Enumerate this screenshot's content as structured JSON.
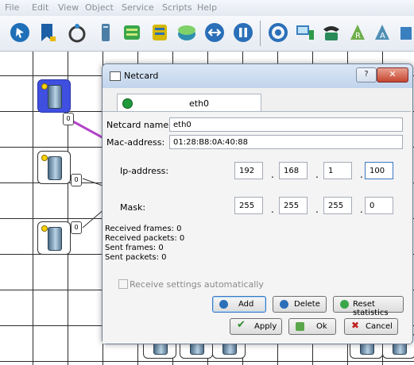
{
  "menu": [
    "File",
    "Edit",
    "View",
    "Object",
    "Service",
    "Scripts",
    "Help"
  ],
  "toolbar_icons": [
    "pointer-icon",
    "bookmark-icon",
    "cable-icon",
    "computer-icon",
    "hub-icon",
    "switch-icon",
    "router-icon",
    "connect-icon",
    "pause-icon",
    "settings-icon",
    "workstation-icon",
    "phone-icon",
    "router-r-icon",
    "router-a-icon"
  ],
  "canvas": {
    "ports": [
      "0",
      "0",
      "0"
    ]
  },
  "dialog": {
    "title": "Netcard",
    "help_label": "?",
    "close_label": "✕",
    "tab_label": "eth0",
    "netcard_name_label": "Netcard name:",
    "netcard_name": "eth0",
    "mac_label": "Mac-address:",
    "mac": "01:28:B8:0A:40:88",
    "ip_label": "Ip-address:",
    "ip": [
      "192",
      "168",
      "1",
      "100"
    ],
    "mask_label": "Mask:",
    "mask": [
      "255",
      "255",
      "255",
      "0"
    ],
    "received_frames": "Received frames: 0",
    "received_packets": "Received packets: 0",
    "sent_frames": "Sent frames: 0",
    "sent_packets": "Sent packets: 0",
    "receive_auto_label": "Receive settings automatically",
    "add_label": "Add",
    "delete_label": "Delete",
    "reset_label": "Reset statistics",
    "apply_label": "Apply",
    "ok_label": "Ok",
    "cancel_label": "Cancel"
  },
  "colors": {
    "accent": "#3a78c2",
    "selected_node": "#3f4fe0",
    "link": "#b244c8",
    "close": "#c5452f"
  }
}
